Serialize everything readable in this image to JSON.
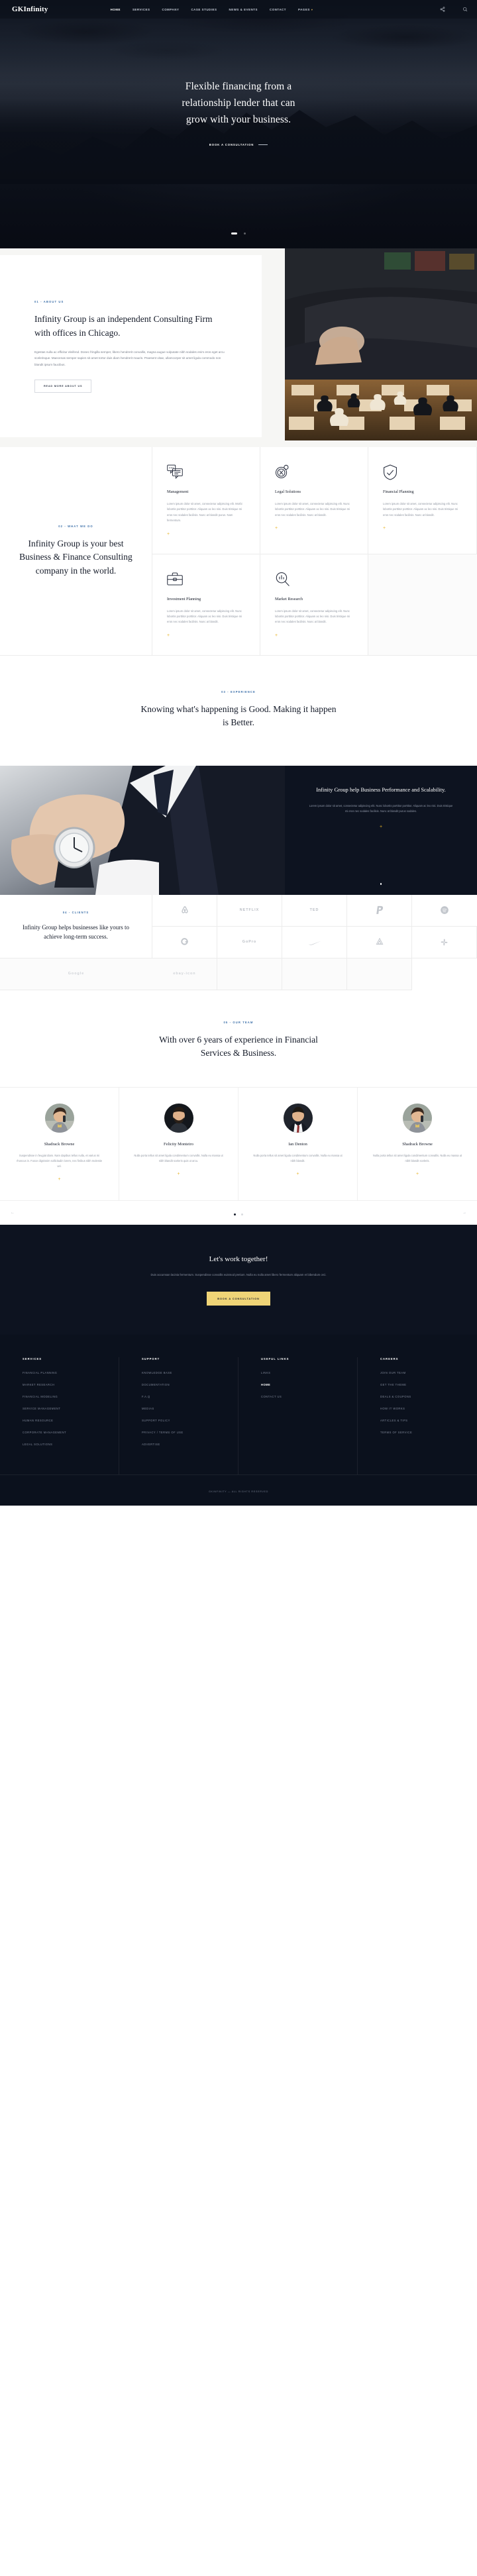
{
  "header": {
    "brand": "GKInfinity",
    "nav": [
      {
        "label": "HOME",
        "active": true
      },
      {
        "label": "SERVICES",
        "active": false
      },
      {
        "label": "COMPANY",
        "active": false
      },
      {
        "label": "CASE STUDIES",
        "active": false
      },
      {
        "label": "NEWS & EVENTS",
        "active": false
      },
      {
        "label": "CONTACT",
        "active": false
      },
      {
        "label": "PAGES",
        "active": false,
        "caret": true
      }
    ],
    "share_icon": "share-icon",
    "search_icon": "search-icon"
  },
  "hero": {
    "title_line1": "Flexible financing from a",
    "title_line2": "relationship lender that can",
    "title_line3": "grow with your business.",
    "cta": "BOOK A CONSULTATION",
    "slides": 2,
    "active_slide": 1
  },
  "about": {
    "eyebrow": "01 - ABOUT US",
    "heading": "Infinity Group is an independent Consulting Firm with offices in Chicago.",
    "paragraph": "Egestas nulla ac efficitur eleifend. Donec fringilla semper, libero hendrerit convallis, magna augue vulputate nibh sodales enim eros eget arcu scelerisque. Maecenas semper sapien sit amet tortor duis diam hendrerit mauris. Praesent vitae, ullam­corper sit amet ligula commodo non blandit ipsum faucibus.",
    "button": "READ MORE ABOUT US"
  },
  "services": {
    "eyebrow": "02 - WHAT WE DO",
    "heading": "Infinity Group is your best Business & Finance Consulting company in the world.",
    "items": [
      {
        "icon": "chat-bubble-icon",
        "title": "Management",
        "text": "Lorem ipsum dolor sit amet, consectetur adipiscing elit. Morbi lobortis porttitor porttitor. Aliquam ac leo nisi. Duis tristique mi eros nec sodales facilisis. Nunc at blandit purus. Nam fermentum."
      },
      {
        "icon": "compass-icon",
        "title": "Legal Solutions",
        "text": "Lorem ipsum dolor sit amet, consectetur adipiscing elit. Nunc lobortis porttitor porttitor. Aliquam ac leo nisi. Duis tristique mi eros nec sodales facilisis. Nunc at blandit."
      },
      {
        "icon": "shield-icon",
        "title": "Financial Planning",
        "text": "Lorem ipsum dolor sit amet, consectetur adipiscing elit. Nunc lobortis porttitor porttitor. Aliquam ac leo nisi. Duis tristique mi eros nec sodales facilisis. Nunc at blandit."
      },
      {
        "icon": "briefcase-icon",
        "title": "Investment Planning",
        "text": "Lorem ipsum dolor sit amet, consectetur adipiscing elit. Nunc lobortis porttitor porttitor. Aliquam ac leo nisi. Duis tristique mi eros nec sodales facilisis. Nunc at blandit."
      },
      {
        "icon": "magnifier-chart-icon",
        "title": "Market Research",
        "text": "Lorem ipsum dolor sit amet, consectetur adipiscing elit. Nunc lobortis porttitor porttitor. Aliquam ac leo nisi. Duis tristique mi eros nec sodales facilisis. Nunc at blandit."
      }
    ],
    "plus": "+"
  },
  "banner": {
    "eyebrow": "03 - EXPERIENCE",
    "heading": "Knowing what's happening is Good. Making it happen is Better."
  },
  "performance": {
    "heading": "Infinity Group help Business Performance and Scalability.",
    "paragraph": "Lorem ipsum dolor sit amet, consectetur adipiscing elit. Nunc lobortis porttitor porttitor. Aliquam ac leo nisi. Duis tristique mi eros nec sodales facilisis. Nunc at blandit purus sodales.",
    "plus": "+",
    "slides": 1
  },
  "clients": {
    "eyebrow": "04 - CLIENTS",
    "heading": "Infinity Group helps businesses like yours to achieve long-term success.",
    "logos": [
      "airbnb-icon",
      "NETFLIX",
      "TED",
      "paypal-icon",
      "spotify-icon",
      "grab-icon",
      "GoPro",
      "nike-icon",
      "airbnb-leaf-icon",
      "slack-icon",
      "Google",
      "ebay-icon"
    ]
  },
  "team": {
    "eyebrow": "05 - OUR TEAM",
    "heading": "With over 6 years of experience in Financial Services & Business.",
    "members": [
      {
        "name": "Shadrack Browne",
        "avatar": "avatar-woman-phone",
        "bio": "Suspendisse in feugiat diam. Nam dapibus tellus nulla, et varius mi rhoncus in. Fusce dignissim sollicitudin lorem, nec finibus nibh molestie vel."
      },
      {
        "name": "Felicity Monteiro",
        "avatar": "avatar-man-beard",
        "bio": "Nulla porta tellus sit amet ligula condimentum convallis. Nulla eu massa ut nibh blandit sceleris quis ut arcu."
      },
      {
        "name": "Ian Denton",
        "avatar": "avatar-man-suit",
        "bio": "Nulla porta tellus sit amet ligula condimentum convallis. Nulla eu massa ut nibh blandit."
      },
      {
        "name": "Shadrack Browne",
        "avatar": "avatar-woman-phone-2",
        "bio": "Nulla porta tellus sit amet ligula condimentum convallis. Nulla eu massa ut nibh blandit sceleris."
      }
    ],
    "plus": "+",
    "prev_icon": "arrow-left-icon",
    "next_icon": "arrow-right-icon"
  },
  "cta": {
    "heading": "Let's work together!",
    "paragraph": "Duis accumsan lacinia fermentum. Suspendisse convallis euismod pretium. Nulla eu nulla amet libero fermentum aliquam et bibendum orci.",
    "button": "BOOK A CONSULTATION"
  },
  "footer": {
    "columns": [
      {
        "title": "SERVICES",
        "links": [
          {
            "label": "FINANCIAL PLANNING"
          },
          {
            "label": "MARKET RESEARCH"
          },
          {
            "label": "FINANCIAL MODELING"
          },
          {
            "label": "SERVICE MANAGEMENT"
          },
          {
            "label": "HUMAN RESOURCE"
          },
          {
            "label": "CORPORATE MANAGEMENT"
          },
          {
            "label": "LEGAL SOLUTIONS"
          }
        ]
      },
      {
        "title": "SUPPORT",
        "links": [
          {
            "label": "KNOWLEDGE BASE"
          },
          {
            "label": "DOCUMENTATION"
          },
          {
            "label": "F.A.Q"
          },
          {
            "label": "MEDIAS"
          },
          {
            "label": "SUPPORT POLICY"
          },
          {
            "label": "PRIVACY / TERMS OF USE"
          },
          {
            "label": "ADVERTISE"
          }
        ]
      },
      {
        "title": "USEFUL LINKS",
        "links": [
          {
            "label": "LINKS"
          },
          {
            "label": "HOME",
            "on": true
          },
          {
            "label": "CONTACT US"
          }
        ]
      },
      {
        "title": "CAREERS",
        "links": [
          {
            "label": "JOIN OUR TEAM"
          },
          {
            "label": "GET THE THEME"
          },
          {
            "label": "DEALS & COUPONS"
          },
          {
            "label": "HOW IT WORKS"
          },
          {
            "label": "ARTICLES & TIPS"
          },
          {
            "label": "TERMS OF SERVICE"
          }
        ]
      }
    ],
    "copyright": "GKINFINITY — ALL RIGHTS RESERVED"
  }
}
